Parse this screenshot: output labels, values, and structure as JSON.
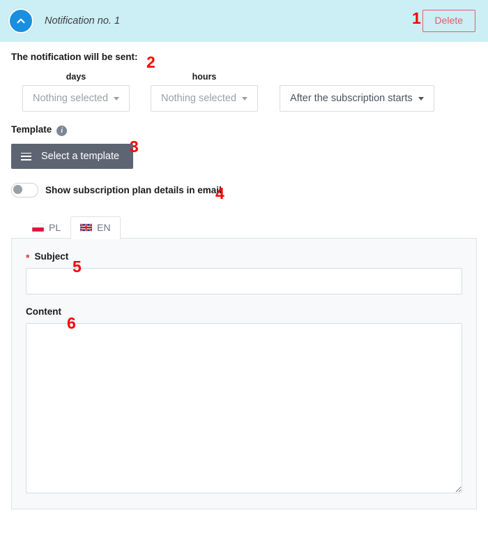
{
  "header": {
    "collapse_icon": "chevron-up-icon",
    "title": "Notification no. 1",
    "delete_label": "Delete"
  },
  "form": {
    "sent_label": "The notification will be sent:",
    "selects": [
      {
        "caption": "days",
        "value": "Nothing selected",
        "state": "placeholder"
      },
      {
        "caption": "hours",
        "value": "Nothing selected",
        "state": "placeholder"
      },
      {
        "caption": "",
        "value": "After the subscription starts",
        "state": "chosen"
      }
    ],
    "template": {
      "label": "Template",
      "info_icon": "info-circle-icon",
      "button_label": "Select a template",
      "button_icon": "list-menu-icon"
    },
    "toggle": {
      "label": "Show subscription plan details in email",
      "state": "off"
    }
  },
  "tabs": [
    {
      "label": "PL",
      "flag": "flag-poland-icon",
      "active": false
    },
    {
      "label": "EN",
      "flag": "flag-uk-icon",
      "active": true
    }
  ],
  "panel": {
    "subject": {
      "label": "Subject",
      "required_marker": "*",
      "value": "",
      "placeholder": ""
    },
    "content": {
      "label": "Content",
      "value": "",
      "placeholder": ""
    }
  },
  "annotations": [
    {
      "number": "1",
      "target": "delete-button"
    },
    {
      "number": "2",
      "target": "notification-sent-label"
    },
    {
      "number": "3",
      "target": "select-template-button"
    },
    {
      "number": "4",
      "target": "show-plan-details-toggle"
    },
    {
      "number": "5",
      "target": "subject-field"
    },
    {
      "number": "6",
      "target": "content-field"
    }
  ],
  "colors": {
    "header_bg": "#cceef5",
    "accent_blue": "#1a8fe0",
    "danger_red": "#e35d6a",
    "annotation_red": "#ff0000",
    "template_btn": "#5e6572",
    "panel_bg": "#f7f9fb"
  }
}
